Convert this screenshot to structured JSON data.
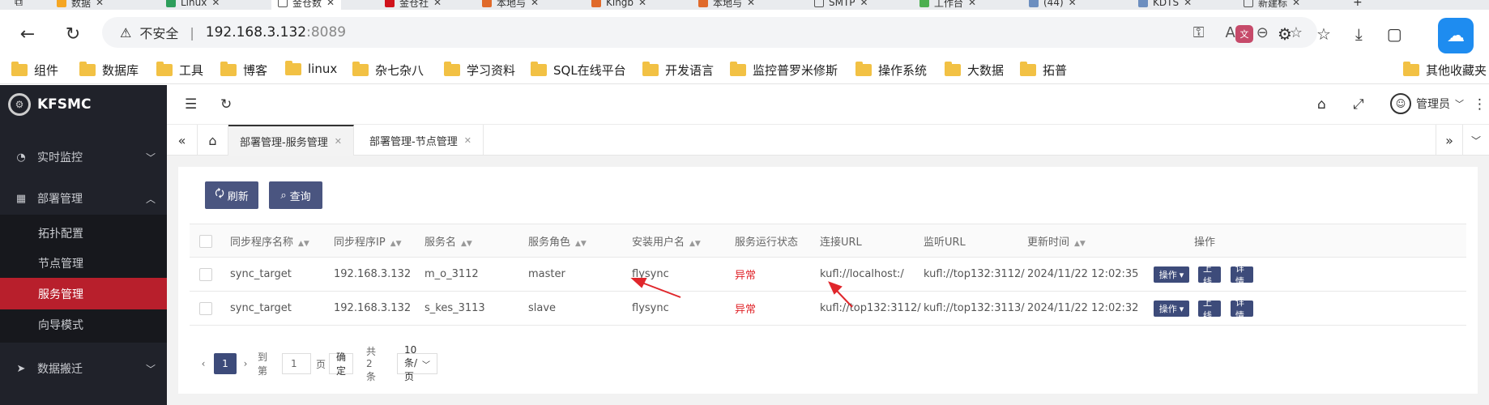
{
  "browser": {
    "tabs": [
      {
        "label": "数据"
      },
      {
        "label": "Linux"
      },
      {
        "label": "金仓数"
      },
      {
        "label": "金仓社"
      },
      {
        "label": "本地与"
      },
      {
        "label": "Kingb"
      },
      {
        "label": "本地与"
      },
      {
        "label": "SMTP"
      },
      {
        "label": "工作台"
      },
      {
        "label": "(44)"
      },
      {
        "label": "KDTS"
      },
      {
        "label": "新建标"
      }
    ],
    "insecure_label": "不安全",
    "url_host": "192.168.3.132",
    "url_port": ":8089",
    "bookmarks": [
      "组件",
      "数据库",
      "工具",
      "博客",
      "linux",
      "杂七杂八",
      "学习资料",
      "SQL在线平台",
      "开发语言",
      "监控普罗米修斯",
      "操作系统",
      "大数据",
      "拓普",
      "其他收藏夹"
    ]
  },
  "app": {
    "logo": "KFSMC",
    "menu": {
      "realtime": "实时监控",
      "deploy": "部署管理",
      "deploy_sub": [
        "拓扑配置",
        "节点管理",
        "服务管理",
        "向导模式"
      ],
      "migrate": "数据搬迁"
    },
    "user": "管理员",
    "page_tabs": [
      {
        "label": "部署管理-服务管理"
      },
      {
        "label": "部署管理-节点管理"
      }
    ],
    "buttons": {
      "refresh": "刷新",
      "query": "查询"
    },
    "columns": [
      "同步程序名称",
      "同步程序IP",
      "服务名",
      "服务角色",
      "安装用户名",
      "服务运行状态",
      "连接URL",
      "监听URL",
      "更新时间",
      "操作"
    ],
    "rows": [
      {
        "name": "sync_target",
        "ip": "192.168.3.132",
        "service": "m_o_3112",
        "role": "master",
        "user": "flysync",
        "status": "异常",
        "conn_url": "kufl://localhost:/",
        "listen_url": "kufl://top132:3112/",
        "updated": "2024/11/22 12:02:35",
        "op": "操作",
        "online": "上线",
        "detail": "详情"
      },
      {
        "name": "sync_target",
        "ip": "192.168.3.132",
        "service": "s_kes_3113",
        "role": "slave",
        "user": "flysync",
        "status": "异常",
        "conn_url": "kufl://top132:3112/",
        "listen_url": "kufl://top132:3113/",
        "updated": "2024/11/22 12:02:32",
        "op": "操作",
        "online": "上线",
        "detail": "详情"
      }
    ],
    "pager": {
      "current": "1",
      "goto_label": "到第",
      "goto_value": "1",
      "page_unit": "页",
      "confirm": "确定",
      "total": "共 2 条",
      "page_size": "10 条/页"
    }
  },
  "colors": {
    "sidebar": "#20222a",
    "active_menu": "#b81f2c",
    "primary_button": "#4a5580",
    "error_text": "#e0262b",
    "annotation_arrow": "#e0262b"
  }
}
